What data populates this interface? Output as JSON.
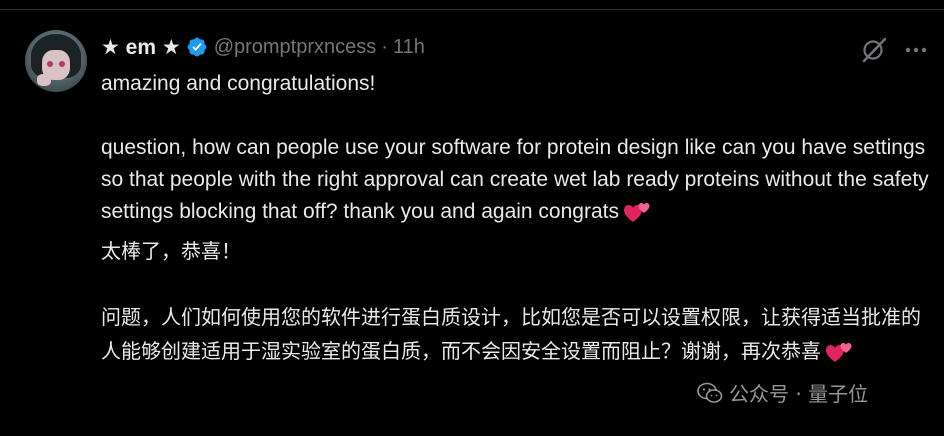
{
  "tweet": {
    "author_name": "★ em ★",
    "verified": true,
    "handle": "@promptprxncess",
    "separator": "·",
    "time": "11h",
    "lines": {
      "l1": "amazing and congratulations!",
      "l2": "question, how can people use your software for protein design like can you have settings so that people with the right approval can create wet lab ready proteins without the safety settings blocking that off? thank you and again congrats",
      "l3": "太棒了，恭喜！",
      "l4": "问题，人们如何使用您的软件进行蛋白质设计，比如您是否可以设置权限，让获得适当批准的人能够创建适用于湿实验室的蛋白质，而不会因安全设置而阻止？谢谢，再次恭喜"
    },
    "icons": {
      "verified": "verified-badge-icon",
      "grok": "grok-icon",
      "more": "more-options-icon",
      "emoji": "two-hearts-emoji-icon"
    }
  },
  "watermark": {
    "text": "公众号 · 量子位",
    "icon": "wechat-icon"
  },
  "colors": {
    "background": "#000000",
    "text_primary": "#e7e9ea",
    "text_secondary": "#71767b",
    "verified_blue": "#1d9bf0",
    "heart_pink": "#e0245e"
  }
}
